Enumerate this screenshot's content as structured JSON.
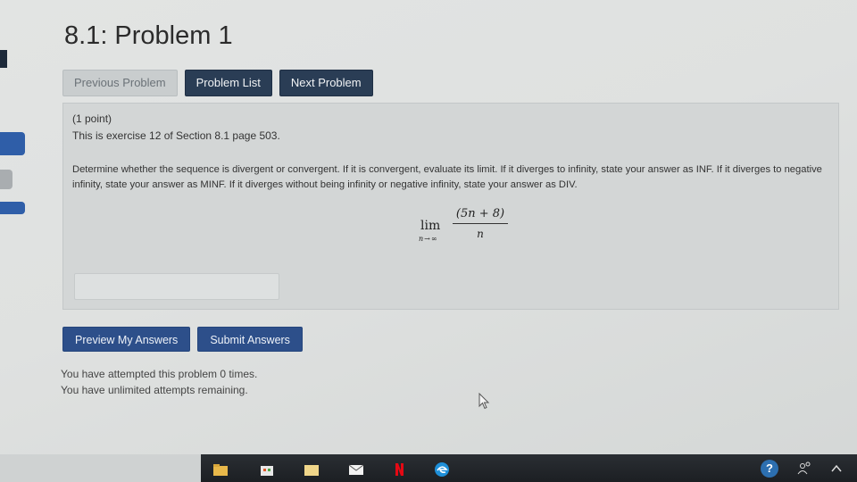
{
  "page": {
    "title": "8.1: Problem 1"
  },
  "nav": {
    "previous_label": "Previous Problem",
    "list_label": "Problem List",
    "next_label": "Next Problem"
  },
  "problem": {
    "points": "(1 point)",
    "exercise": "This is exercise 12 of Section 8.1 page 503.",
    "question": "Determine whether the sequence is divergent or convergent. If it is convergent, evaluate its limit. If it diverges to infinity, state your answer as INF. If it diverges to negative infinity, state your answer as MINF. If it diverges without being infinity or negative infinity, state your answer as DIV.",
    "math": {
      "lim": "lim",
      "lim_sub": "n→∞",
      "numerator": "(5n + 8)",
      "denominator": "n"
    },
    "answer_value": ""
  },
  "actions": {
    "preview_label": "Preview My Answers",
    "submit_label": "Submit Answers"
  },
  "attempts": {
    "line1": "You have attempted this problem 0 times.",
    "line2": "You have unlimited attempts remaining."
  },
  "colors": {
    "nav_primary": "#2a3d55",
    "action_primary": "#2d4f8a",
    "disabled_button": "#c9cdce",
    "taskbar": "#1c1f23"
  },
  "taskbar": {
    "icons": [
      "file-explorer-icon",
      "store-icon",
      "mail-icon",
      "netflix-icon",
      "edge-icon"
    ],
    "tray_icons": [
      "help-icon",
      "people-icon",
      "chevron-up-icon"
    ],
    "help_glyph": "?"
  }
}
